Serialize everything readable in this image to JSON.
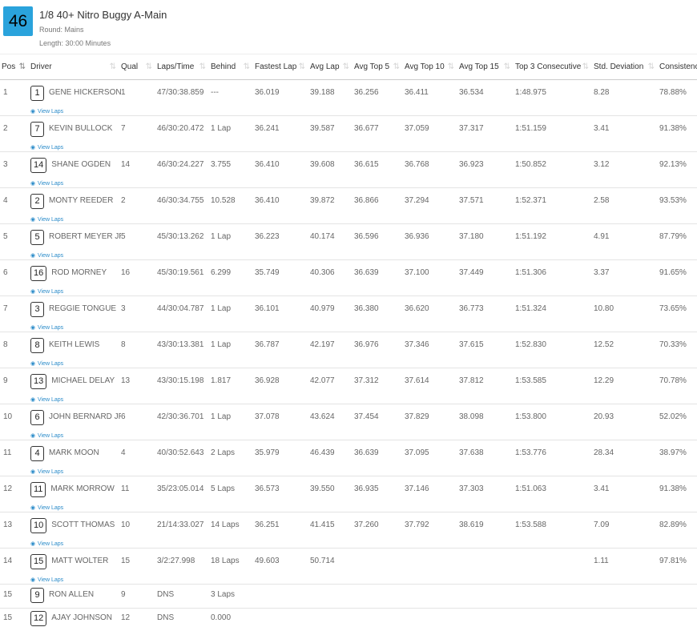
{
  "race": {
    "number": "46",
    "title": "1/8 40+ Nitro Buggy A-Main",
    "round": "Round: Mains",
    "length": "Length: 30:00 Minutes"
  },
  "columns": [
    {
      "key": "pos",
      "label": "Pos"
    },
    {
      "key": "driver",
      "label": "Driver"
    },
    {
      "key": "qual",
      "label": "Qual"
    },
    {
      "key": "laps_time",
      "label": "Laps/Time"
    },
    {
      "key": "behind",
      "label": "Behind"
    },
    {
      "key": "fastest_lap",
      "label": "Fastest Lap"
    },
    {
      "key": "avg_lap",
      "label": "Avg Lap"
    },
    {
      "key": "avg_top5",
      "label": "Avg Top 5"
    },
    {
      "key": "avg_top10",
      "label": "Avg Top 10"
    },
    {
      "key": "avg_top15",
      "label": "Avg Top 15"
    },
    {
      "key": "top3_consecutive",
      "label": "Top 3 Consecutive"
    },
    {
      "key": "std_dev",
      "label": "Std. Deviation"
    },
    {
      "key": "consistency",
      "label": "Consistency"
    }
  ],
  "view_laps_label": "View Laps",
  "rows": [
    {
      "pos": "1",
      "car": "1",
      "name": "GENE HICKERSON",
      "qual": "1",
      "laps_time": "47/30:38.859",
      "behind": "---",
      "fastest_lap": "36.019",
      "avg_lap": "39.188",
      "avg_top5": "36.256",
      "avg_top10": "36.411",
      "avg_top15": "36.534",
      "top3_consecutive": "1:48.975",
      "std_dev": "8.28",
      "consistency": "78.88%"
    },
    {
      "pos": "2",
      "car": "7",
      "name": "KEVIN BULLOCK",
      "qual": "7",
      "laps_time": "46/30:20.472",
      "behind": "1 Lap",
      "fastest_lap": "36.241",
      "avg_lap": "39.587",
      "avg_top5": "36.677",
      "avg_top10": "37.059",
      "avg_top15": "37.317",
      "top3_consecutive": "1:51.159",
      "std_dev": "3.41",
      "consistency": "91.38%"
    },
    {
      "pos": "3",
      "car": "14",
      "name": "SHANE OGDEN",
      "qual": "14",
      "laps_time": "46/30:24.227",
      "behind": "3.755",
      "fastest_lap": "36.410",
      "avg_lap": "39.608",
      "avg_top5": "36.615",
      "avg_top10": "36.768",
      "avg_top15": "36.923",
      "top3_consecutive": "1:50.852",
      "std_dev": "3.12",
      "consistency": "92.13%"
    },
    {
      "pos": "4",
      "car": "2",
      "name": "MONTY REEDER",
      "qual": "2",
      "laps_time": "46/30:34.755",
      "behind": "10.528",
      "fastest_lap": "36.410",
      "avg_lap": "39.872",
      "avg_top5": "36.866",
      "avg_top10": "37.294",
      "avg_top15": "37.571",
      "top3_consecutive": "1:52.371",
      "std_dev": "2.58",
      "consistency": "93.53%"
    },
    {
      "pos": "5",
      "car": "5",
      "name": "ROBERT MEYER JR.",
      "qual": "5",
      "laps_time": "45/30:13.262",
      "behind": "1 Lap",
      "fastest_lap": "36.223",
      "avg_lap": "40.174",
      "avg_top5": "36.596",
      "avg_top10": "36.936",
      "avg_top15": "37.180",
      "top3_consecutive": "1:51.192",
      "std_dev": "4.91",
      "consistency": "87.79%"
    },
    {
      "pos": "6",
      "car": "16",
      "name": "ROD MORNEY",
      "qual": "16",
      "laps_time": "45/30:19.561",
      "behind": "6.299",
      "fastest_lap": "35.749",
      "avg_lap": "40.306",
      "avg_top5": "36.639",
      "avg_top10": "37.100",
      "avg_top15": "37.449",
      "top3_consecutive": "1:51.306",
      "std_dev": "3.37",
      "consistency": "91.65%"
    },
    {
      "pos": "7",
      "car": "3",
      "name": "REGGIE TONGUE",
      "qual": "3",
      "laps_time": "44/30:04.787",
      "behind": "1 Lap",
      "fastest_lap": "36.101",
      "avg_lap": "40.979",
      "avg_top5": "36.380",
      "avg_top10": "36.620",
      "avg_top15": "36.773",
      "top3_consecutive": "1:51.324",
      "std_dev": "10.80",
      "consistency": "73.65%"
    },
    {
      "pos": "8",
      "car": "8",
      "name": "KEITH LEWIS",
      "qual": "8",
      "laps_time": "43/30:13.381",
      "behind": "1 Lap",
      "fastest_lap": "36.787",
      "avg_lap": "42.197",
      "avg_top5": "36.976",
      "avg_top10": "37.346",
      "avg_top15": "37.615",
      "top3_consecutive": "1:52.830",
      "std_dev": "12.52",
      "consistency": "70.33%"
    },
    {
      "pos": "9",
      "car": "13",
      "name": "MICHAEL DELAY",
      "qual": "13",
      "laps_time": "43/30:15.198",
      "behind": "1.817",
      "fastest_lap": "36.928",
      "avg_lap": "42.077",
      "avg_top5": "37.312",
      "avg_top10": "37.614",
      "avg_top15": "37.812",
      "top3_consecutive": "1:53.585",
      "std_dev": "12.29",
      "consistency": "70.78%"
    },
    {
      "pos": "10",
      "car": "6",
      "name": "JOHN BERNARD JR.",
      "qual": "6",
      "laps_time": "42/30:36.701",
      "behind": "1 Lap",
      "fastest_lap": "37.078",
      "avg_lap": "43.624",
      "avg_top5": "37.454",
      "avg_top10": "37.829",
      "avg_top15": "38.098",
      "top3_consecutive": "1:53.800",
      "std_dev": "20.93",
      "consistency": "52.02%"
    },
    {
      "pos": "11",
      "car": "4",
      "name": "MARK MOON",
      "qual": "4",
      "laps_time": "40/30:52.643",
      "behind": "2 Laps",
      "fastest_lap": "35.979",
      "avg_lap": "46.439",
      "avg_top5": "36.639",
      "avg_top10": "37.095",
      "avg_top15": "37.638",
      "top3_consecutive": "1:53.776",
      "std_dev": "28.34",
      "consistency": "38.97%"
    },
    {
      "pos": "12",
      "car": "11",
      "name": "MARK MORROW",
      "qual": "11",
      "laps_time": "35/23:05.014",
      "behind": "5 Laps",
      "fastest_lap": "36.573",
      "avg_lap": "39.550",
      "avg_top5": "36.935",
      "avg_top10": "37.146",
      "avg_top15": "37.303",
      "top3_consecutive": "1:51.063",
      "std_dev": "3.41",
      "consistency": "91.38%"
    },
    {
      "pos": "13",
      "car": "10",
      "name": "SCOTT THOMAS",
      "qual": "10",
      "laps_time": "21/14:33.027",
      "behind": "14 Laps",
      "fastest_lap": "36.251",
      "avg_lap": "41.415",
      "avg_top5": "37.260",
      "avg_top10": "37.792",
      "avg_top15": "38.619",
      "top3_consecutive": "1:53.588",
      "std_dev": "7.09",
      "consistency": "82.89%"
    },
    {
      "pos": "14",
      "car": "15",
      "name": "MATT WOLTER",
      "qual": "15",
      "laps_time": "3/2:27.998",
      "behind": "18 Laps",
      "fastest_lap": "49.603",
      "avg_lap": "50.714",
      "avg_top5": "",
      "avg_top10": "",
      "avg_top15": "",
      "top3_consecutive": "",
      "std_dev": "1.11",
      "consistency": "97.81%"
    },
    {
      "pos": "15",
      "car": "9",
      "name": "RON ALLEN",
      "qual": "9",
      "laps_time": "DNS",
      "behind": "3 Laps",
      "fastest_lap": "",
      "avg_lap": "",
      "avg_top5": "",
      "avg_top10": "",
      "avg_top15": "",
      "top3_consecutive": "",
      "std_dev": "",
      "consistency": ""
    },
    {
      "pos": "15",
      "car": "12",
      "name": "AJAY JOHNSON",
      "qual": "12",
      "laps_time": "DNS",
      "behind": "0.000",
      "fastest_lap": "",
      "avg_lap": "",
      "avg_top5": "",
      "avg_top10": "",
      "avg_top15": "",
      "top3_consecutive": "",
      "std_dev": "",
      "consistency": ""
    }
  ]
}
